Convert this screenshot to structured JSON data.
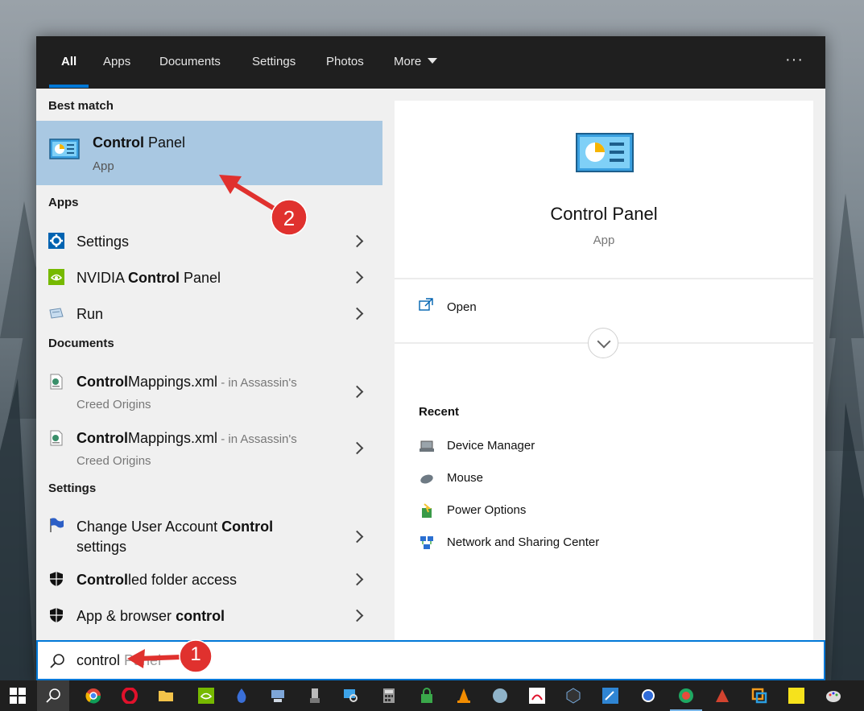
{
  "tabs": [
    {
      "label": "All",
      "active": true
    },
    {
      "label": "Apps"
    },
    {
      "label": "Documents"
    },
    {
      "label": "Settings"
    },
    {
      "label": "Photos"
    },
    {
      "label": "More"
    }
  ],
  "overflow_icon": "ellipsis-icon",
  "best_match": {
    "header": "Best match",
    "title_bold": "Control",
    "title_rest": " Panel",
    "subtitle": "App"
  },
  "apps": {
    "header": "Apps",
    "items": [
      {
        "pre": "",
        "bold": "",
        "post": "Settings",
        "icon": "gear-icon"
      },
      {
        "pre": "NVIDIA ",
        "bold": "Control",
        "post": " Panel",
        "icon": "nvidia-icon"
      },
      {
        "pre": "",
        "bold": "",
        "post": "Run",
        "icon": "run-icon"
      }
    ]
  },
  "documents": {
    "header": "Documents",
    "items": [
      {
        "bold": "Control",
        "rest": "Mappings.xml",
        "loc1": " - in Assassin's",
        "loc2": "Creed Origins",
        "icon": "xml-file-icon"
      },
      {
        "bold": "Control",
        "rest": "Mappings.xml",
        "loc1": " - in Assassin's",
        "loc2": "Creed Origins",
        "icon": "xml-file-icon"
      }
    ]
  },
  "settings": {
    "header": "Settings",
    "items": [
      {
        "line1_pre": "Change User Account ",
        "line1_bold": "Control",
        "line2": "settings",
        "icon": "uac-flag-icon"
      },
      {
        "pre": "",
        "bold": "Control",
        "post": "led folder access",
        "icon": "shield-icon"
      },
      {
        "pre": "App & browser ",
        "bold": "control",
        "post": "",
        "icon": "shield-icon"
      }
    ]
  },
  "preview": {
    "title": "Control Panel",
    "subtitle": "App",
    "open_label": "Open",
    "recent_header": "Recent",
    "recent": [
      {
        "label": "Device Manager",
        "icon": "device-manager-icon"
      },
      {
        "label": "Mouse",
        "icon": "mouse-icon"
      },
      {
        "label": "Power Options",
        "icon": "power-options-icon"
      },
      {
        "label": "Network and Sharing Center",
        "icon": "network-icon"
      }
    ]
  },
  "search": {
    "typed": "control",
    "suggestion": " Panel"
  },
  "annotations": [
    {
      "number": "1"
    },
    {
      "number": "2"
    }
  ],
  "colors": {
    "accent": "#0078d7",
    "selection": "#a9c8e2",
    "annotation_red": "#e0312e"
  }
}
